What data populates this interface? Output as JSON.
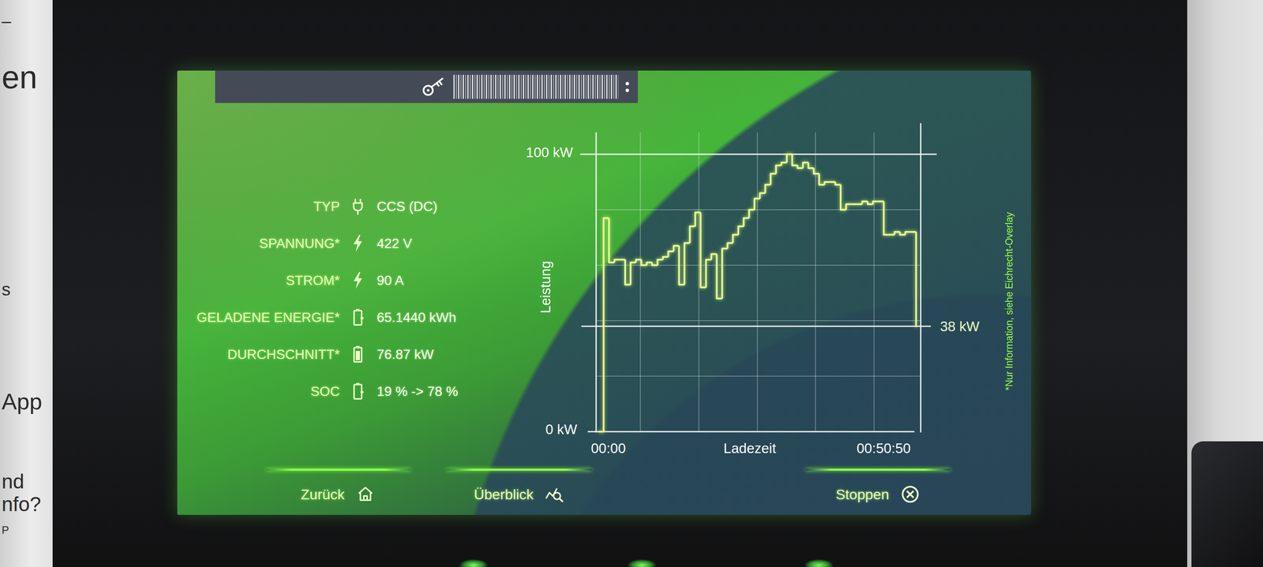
{
  "edge": {
    "fragments": [
      "–",
      "en",
      "s",
      "App",
      "nd",
      "nfo?",
      "P"
    ]
  },
  "info": [
    {
      "label": "TYP",
      "value": "CCS (DC)"
    },
    {
      "label": "SPANNUNG*",
      "value": "422  V"
    },
    {
      "label": "STROM*",
      "value": "90  A"
    },
    {
      "label": "GELADENE ENERGIE*",
      "value": "65.1440  kWh"
    },
    {
      "label": "DURCHSCHNITT*",
      "value": "76.87  kW"
    },
    {
      "label": "SOC",
      "value": "19 % -> 78 %"
    }
  ],
  "chart": {
    "y_axis_title": "Leistung",
    "x_axis_title": "Ladezeit",
    "y_max": 100,
    "y_max_label": "100 kW",
    "y_min_label": "0 kW",
    "marker_value": 38,
    "marker_label": "38 kW",
    "x_start_label": "00:00",
    "x_end_label": "00:50:50",
    "footnote": "*Nur Information, siehe Eichrecht-Overlay",
    "series": [
      {
        "name": "Leistung",
        "values": [
          0,
          77,
          61,
          62,
          62,
          53,
          61,
          62,
          60,
          61,
          60,
          62,
          63,
          65,
          67,
          53,
          68,
          74,
          79,
          52,
          62,
          64,
          48,
          66,
          68,
          71,
          74,
          77,
          80,
          84,
          86,
          89,
          93,
          96,
          97,
          100,
          96,
          95,
          97,
          95,
          93,
          89,
          90,
          90,
          89,
          80,
          82,
          82,
          82,
          83,
          82,
          83,
          83,
          71,
          71,
          72,
          71,
          72,
          72,
          38
        ]
      }
    ]
  },
  "nav": [
    {
      "label": "Zurück"
    },
    {
      "label": "Überblick"
    },
    {
      "label": "Stoppen"
    }
  ]
}
